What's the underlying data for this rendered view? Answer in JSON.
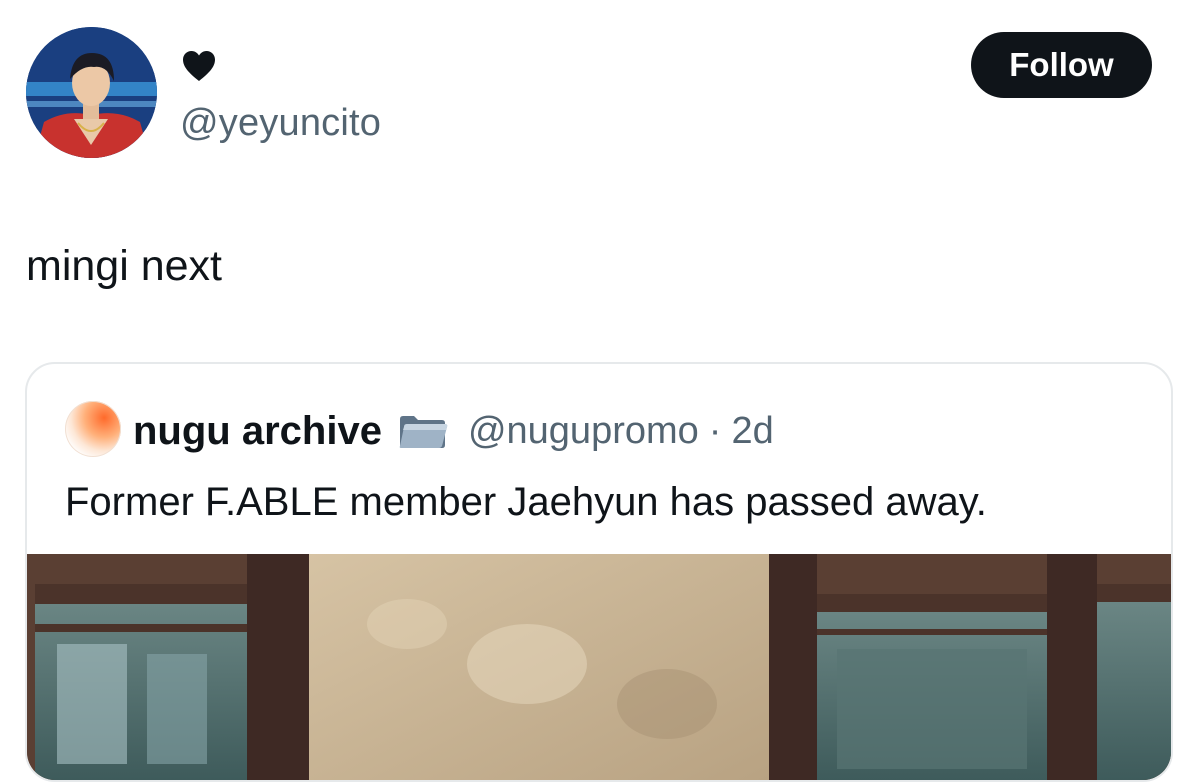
{
  "author": {
    "display_name_icon": "black-heart-icon",
    "handle": "@yeyuncito",
    "avatar_icon": "profile-photo"
  },
  "follow_button": {
    "label": "Follow"
  },
  "post": {
    "text": "mingi next"
  },
  "quote": {
    "author_name": "nugu archive",
    "author_badge_icon": "folder-icon",
    "handle": "@nugupromo",
    "separator": "·",
    "time": "2d",
    "text": "Former F.ABLE member Jaehyun has passed away.",
    "media_icon": "attached-photo"
  },
  "colors": {
    "text_primary": "#0f1419",
    "text_secondary": "#536471",
    "button_bg": "#0f1419",
    "button_text": "#ffffff",
    "card_border": "#e6e9eb"
  }
}
